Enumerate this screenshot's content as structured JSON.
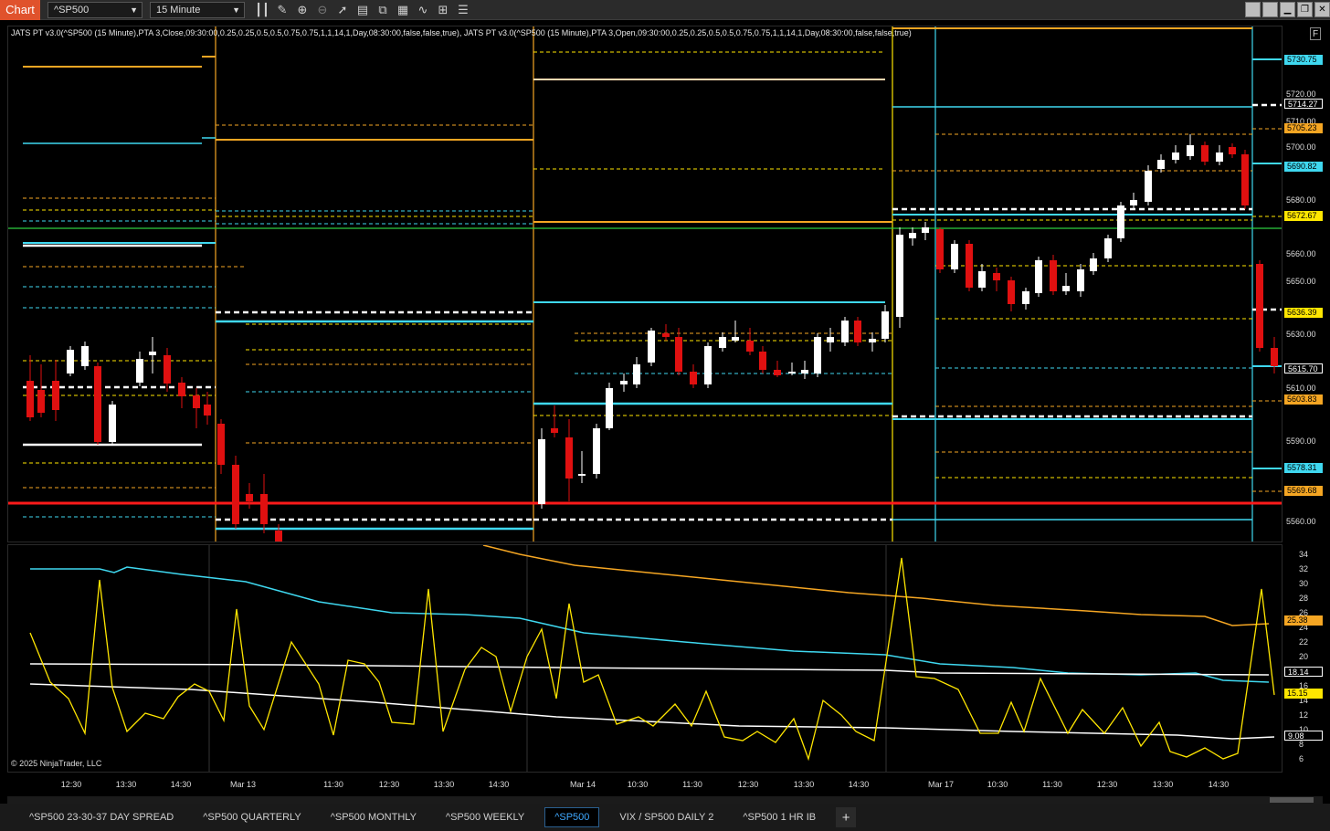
{
  "toolbar": {
    "tab_label": "Chart",
    "instrument": "^SP500",
    "interval": "15 Minute",
    "tools": [
      "bar-style-icon",
      "draw-icon",
      "zoom-in-icon",
      "zoom-out-icon",
      "pointer-icon",
      "data-box-icon",
      "templates-icon",
      "properties-icon",
      "indicators-icon",
      "strategies-icon",
      "list-icon"
    ]
  },
  "window_buttons": [
    "tile-icon",
    "tile2-icon",
    "minimize-icon",
    "restore-icon",
    "close-icon"
  ],
  "chart": {
    "indicator_legend": "JATS PT v3.0(^SP500 (15 Minute),PTA 3,Close,09:30:00,0.25,0.25,0.5,0.5,0.75,0.75,1,1,14,1,Day,08:30:00,false,false,true), JATS PT v3.0(^SP500 (15 Minute),PTA 3,Open,09:30:00,0.25,0.25,0.5,0.5,0.75,0.75,1,1,14,1,Day,08:30:00,false,false,true)",
    "copyright": "© 2025 NinjaTrader, LLC",
    "axis_button": "F",
    "price_axis_labels": [
      "5720.00",
      "5710.00",
      "5700.00",
      "5680.00",
      "5660.00",
      "5650.00",
      "5630.00",
      "5610.00",
      "5590.00",
      "5560.00"
    ],
    "price_tags": [
      {
        "value": "5730.75",
        "color": "#3fd8f0"
      },
      {
        "value": "5714.27",
        "color": "#ffffff"
      },
      {
        "value": "5705.23",
        "color": "#f5a623"
      },
      {
        "value": "5690.82",
        "color": "#3fd8f0"
      },
      {
        "value": "5672.67",
        "color": "#ffe600"
      },
      {
        "value": "5636.39",
        "color": "#ffe600"
      },
      {
        "value": "5615.70",
        "color": "#ffffff"
      },
      {
        "value": "5603.83",
        "color": "#f5a623"
      },
      {
        "value": "5578.31",
        "color": "#3fd8f0"
      },
      {
        "value": "5569.68",
        "color": "#f5a623"
      }
    ],
    "indicator_axis_labels": [
      "34",
      "32",
      "30",
      "28",
      "26",
      "24",
      "22",
      "20",
      "18",
      "16",
      "14",
      "12",
      "10",
      "8",
      "6"
    ],
    "indicator_tags": [
      {
        "value": "25.38",
        "color": "#f5a623"
      },
      {
        "value": "18.14",
        "color": "#ffffff"
      },
      {
        "value": "15.15",
        "color": "#ffe600"
      },
      {
        "value": "9.08",
        "color": "#ffffff"
      }
    ],
    "time_labels": [
      "12:30",
      "13:30",
      "14:30",
      "Mar 13",
      "11:30",
      "12:30",
      "13:30",
      "14:30",
      "Mar 14",
      "10:30",
      "11:30",
      "12:30",
      "13:30",
      "14:30",
      "Mar 17",
      "10:30",
      "11:30",
      "12:30",
      "13:30",
      "14:30"
    ],
    "colors": {
      "up": "#ffffff",
      "down": "#e01010",
      "orange": "#f5a623",
      "cyan": "#3fd8f0",
      "yellow": "#ffe600",
      "red_line": "#ff1a1a",
      "green_line": "#2ecc40"
    }
  },
  "bottom_tabs": [
    "^SP500 23-30-37 DAY SPREAD",
    "^SP500 QUARTERLY",
    "^SP500 MONTHLY",
    "^SP500 WEEKLY",
    "^SP500",
    "VIX / SP500 DAILY 2",
    "^SP500 1 HR IB"
  ],
  "active_tab": "^SP500",
  "add_tab_label": "+"
}
